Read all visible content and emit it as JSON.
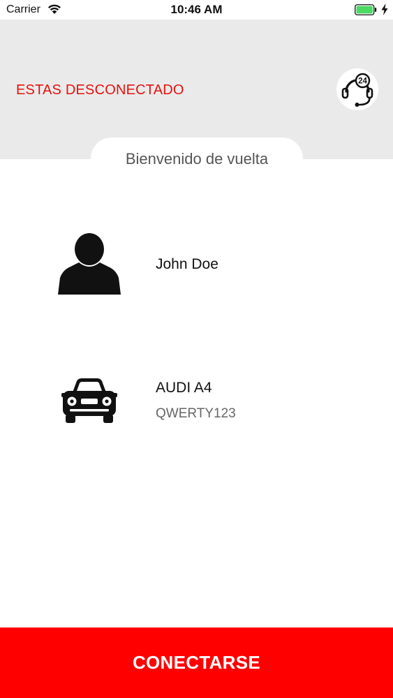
{
  "status_bar": {
    "carrier": "Carrier",
    "time": "10:46 AM",
    "icons": [
      "wifi-icon",
      "battery-icon",
      "charging-bolt-icon"
    ],
    "battery_color": "#4cd964"
  },
  "header": {
    "status_text": "ESTAS DESCONECTADO",
    "status_color": "#e4120f",
    "support_icon": "support-24h-headset-icon",
    "support_badge": "24",
    "background": "#eaeaea"
  },
  "welcome": {
    "text": "Bienvenido de vuelta"
  },
  "user": {
    "icon": "user-avatar-icon",
    "name": "John Doe"
  },
  "vehicle": {
    "icon": "car-icon",
    "model": "AUDI A4",
    "plate": "QWERTY123"
  },
  "actions": {
    "connect_label": "CONECTARSE",
    "connect_color": "#ff0000"
  }
}
